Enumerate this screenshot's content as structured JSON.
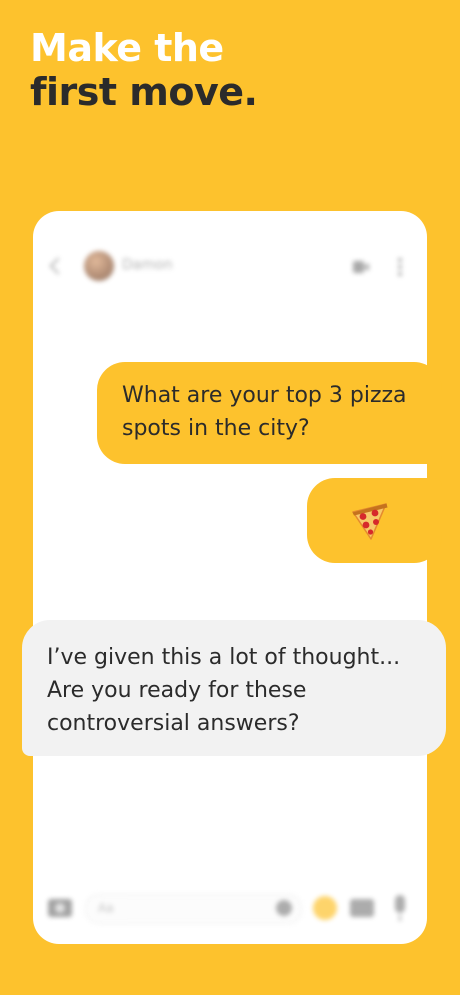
{
  "headline": {
    "line1": "Make the",
    "line2": "first move."
  },
  "chat_header": {
    "contact_name": "Damon"
  },
  "messages": [
    {
      "direction": "outgoing",
      "text": "What are your top 3 pizza spots in the city?"
    },
    {
      "direction": "outgoing",
      "emoji": "pizza-icon"
    },
    {
      "direction": "incoming",
      "text": "I’ve given this a lot of thought... Are you ready for these controversial answers?"
    }
  ],
  "composer": {
    "placeholder": "Aa"
  },
  "colors": {
    "background": "#FDC22D",
    "bubble_outgoing": "#FDC22D",
    "bubble_incoming": "#F2F2F2",
    "headline_line1": "#FFFFFF",
    "headline_line2": "#2B2B2B"
  }
}
